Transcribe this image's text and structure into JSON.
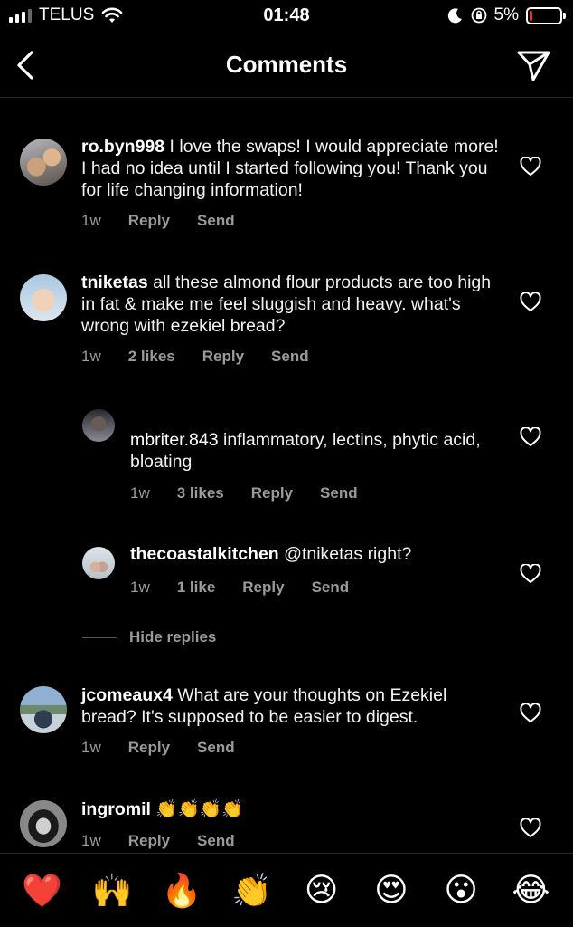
{
  "status_bar": {
    "carrier": "TELUS",
    "time": "01:48",
    "battery_percent": "5%",
    "battery_level": 0.05
  },
  "header": {
    "title": "Comments"
  },
  "comments": [
    {
      "username": "ro.byn998",
      "text": " I love the swaps! I would appreciate more! I had no idea until I started following you! Thank you for life changing information!",
      "time": "1w",
      "reply": "Reply",
      "send": "Send"
    },
    {
      "username": "tniketas",
      "text": " all these almond flour products are too high in fat & make me feel sluggish and heavy. what's wrong with ezekiel bread?",
      "time": "1w",
      "likes": "2 likes",
      "reply": "Reply",
      "send": "Send"
    },
    {
      "username": "mbriter.843",
      "text": " inflammatory, lectins, phytic acid, bloating",
      "time": "1w",
      "likes": "3 likes",
      "reply": "Reply",
      "send": "Send"
    },
    {
      "username": "thecoastalkitchen",
      "text": " @tniketas right?",
      "time": "1w",
      "likes": "1 like",
      "reply": "Reply",
      "send": "Send"
    },
    {
      "username": "jcomeaux4",
      "text": " What are your thoughts on Ezekiel bread? It's supposed to be easier to digest.",
      "time": "1w",
      "reply": "Reply",
      "send": "Send"
    },
    {
      "username": "ingromil",
      "text": " 👏👏👏👏",
      "time": "1w",
      "reply": "Reply",
      "send": "Send"
    }
  ],
  "hide_replies": "Hide replies",
  "emoji_bar": [
    "❤️",
    "🙌",
    "🔥",
    "👏",
    "😢",
    "😍",
    "😮",
    "😂"
  ],
  "colors": {
    "background": "#000000",
    "secondary_text": "#9a9a9a",
    "battery_low": "#ee3333"
  }
}
